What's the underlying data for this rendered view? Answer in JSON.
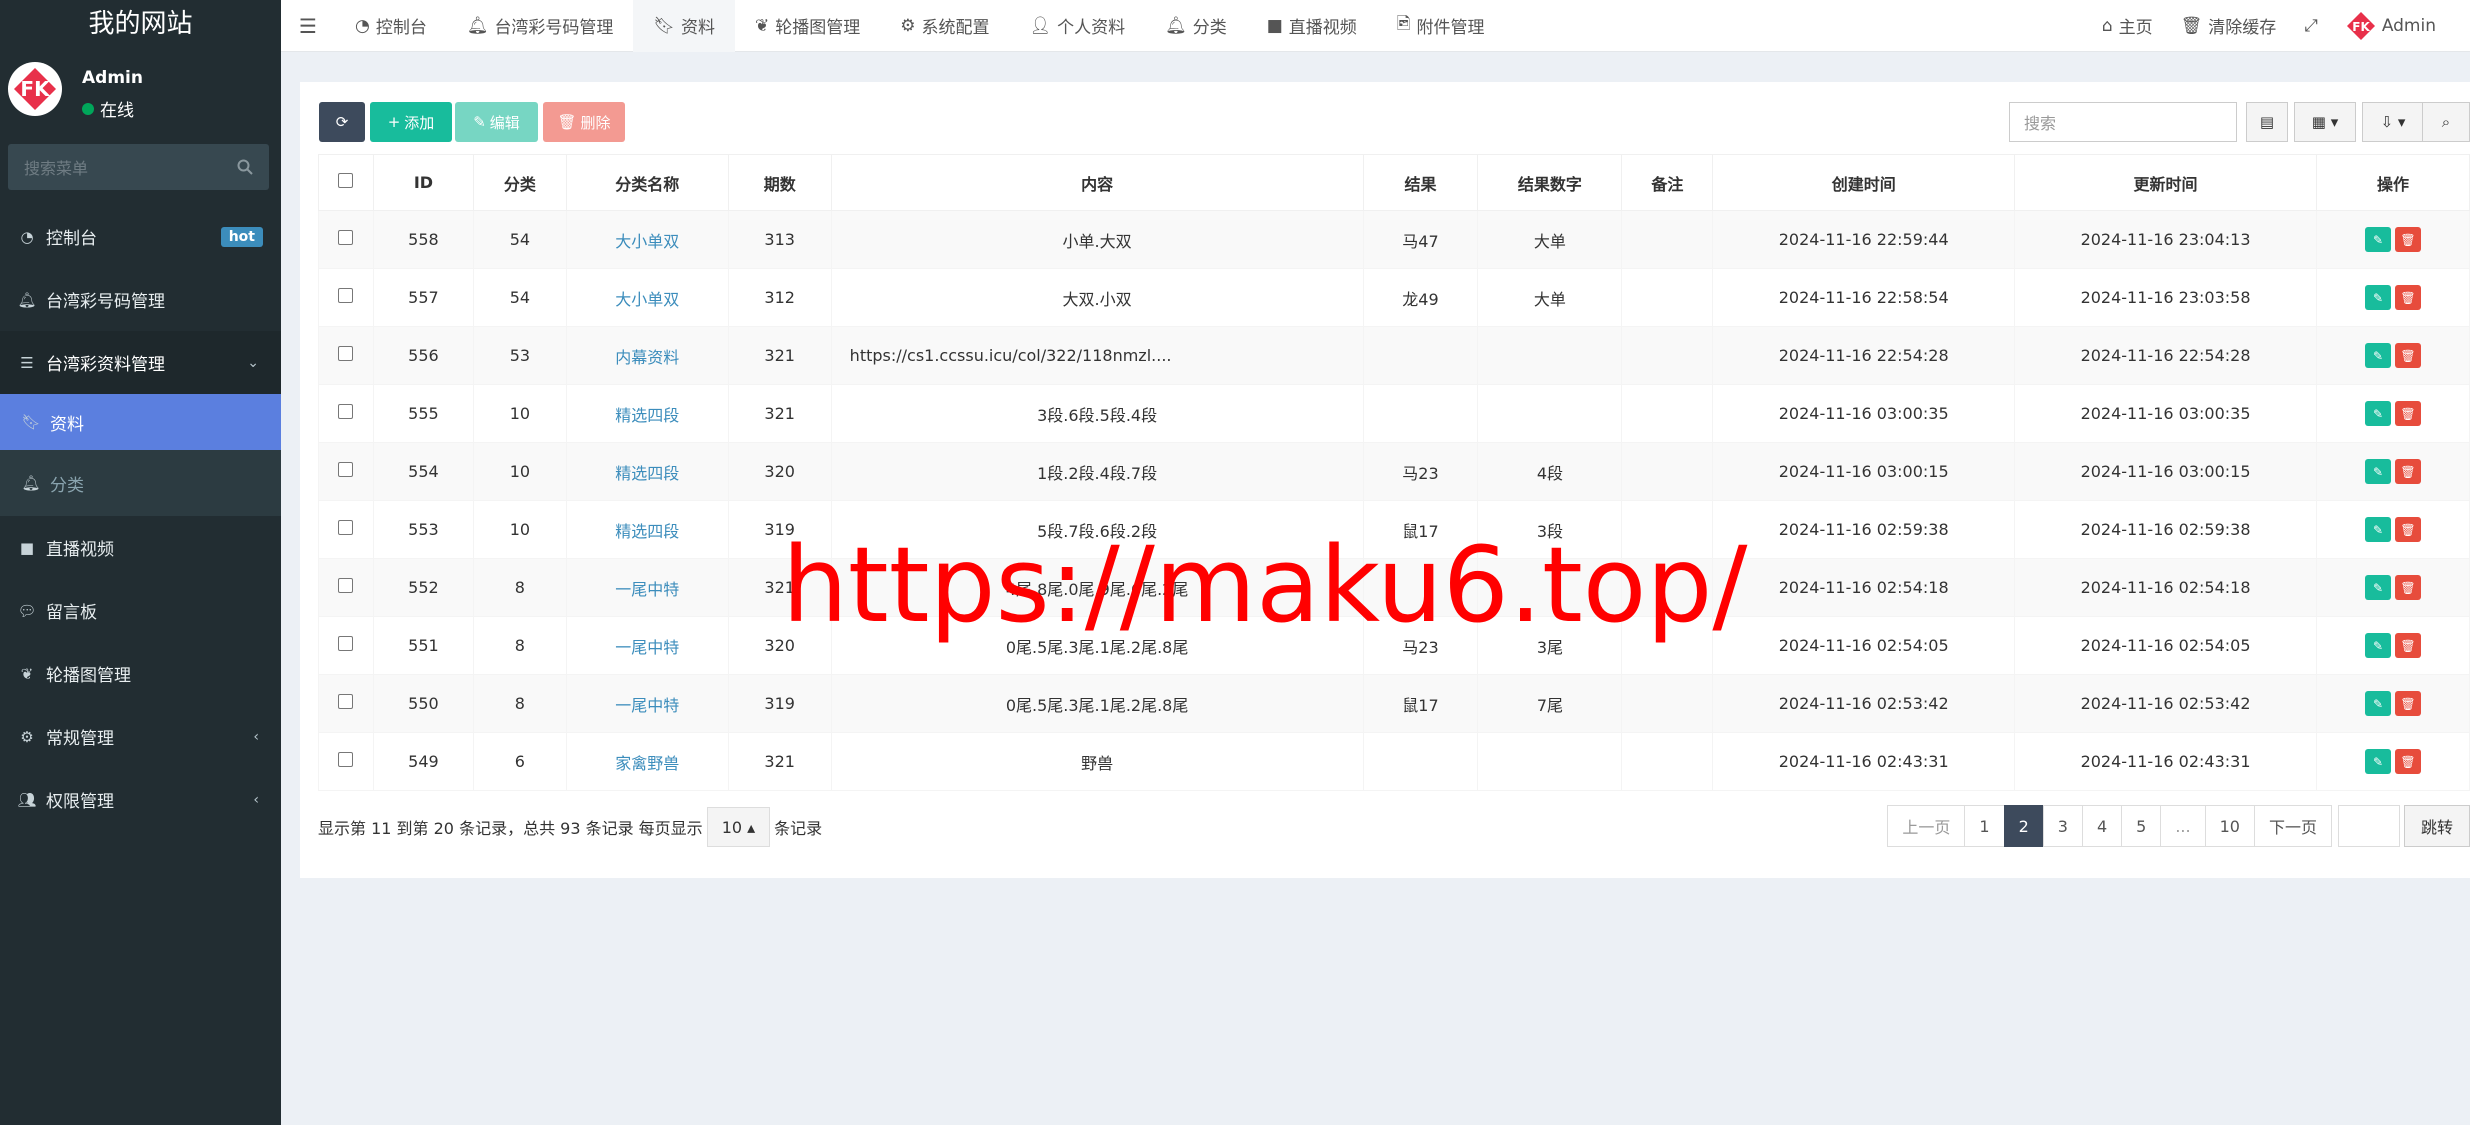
{
  "brand": {
    "title": "我的网站"
  },
  "user": {
    "name": "Admin",
    "status": "在线"
  },
  "side_search": {
    "placeholder": "搜索菜单"
  },
  "menu": [
    {
      "label": "控制台",
      "icon": "dashboard-icon",
      "badge": "hot"
    },
    {
      "label": "台湾彩号码管理",
      "icon": "bell-icon"
    },
    {
      "label": "台湾彩资料管理",
      "icon": "list-icon"
    },
    {
      "label": "资料",
      "icon": "bookmark-icon"
    },
    {
      "label": "分类",
      "icon": "bell-icon"
    },
    {
      "label": "直播视频",
      "icon": "video-icon"
    },
    {
      "label": "留言板",
      "icon": "comment-icon"
    },
    {
      "label": "轮播图管理",
      "icon": "leaf-icon"
    },
    {
      "label": "常规管理",
      "icon": "cogs-icon"
    },
    {
      "label": "权限管理",
      "icon": "users-icon"
    }
  ],
  "tabs": [
    {
      "label": "控制台",
      "icon": "dashboard-icon"
    },
    {
      "label": "台湾彩号码管理",
      "icon": "bell-icon"
    },
    {
      "label": "资料",
      "icon": "bookmark-icon"
    },
    {
      "label": "轮播图管理",
      "icon": "leaf-icon"
    },
    {
      "label": "系统配置",
      "icon": "gear-icon"
    },
    {
      "label": "个人资料",
      "icon": "user-icon"
    },
    {
      "label": "分类",
      "icon": "bell-icon"
    },
    {
      "label": "直播视频",
      "icon": "video-icon"
    },
    {
      "label": "附件管理",
      "icon": "file-image-icon"
    }
  ],
  "topright": {
    "home": "主页",
    "clear_cache": "清除缓存",
    "admin": "Admin"
  },
  "toolbar": {
    "add": "添加",
    "edit": "编辑",
    "delete": "删除",
    "search_placeholder": "搜索"
  },
  "table": {
    "headers": [
      "ID",
      "分类",
      "分类名称",
      "期数",
      "内容",
      "结果",
      "结果数字",
      "备注",
      "创建时间",
      "更新时间",
      "操作"
    ],
    "rows": [
      [
        "558",
        "54",
        "大小单双",
        "313",
        "小单.大双",
        "马47",
        "大单",
        "",
        "2024-11-16 22:59:44",
        "2024-11-16 23:04:13"
      ],
      [
        "557",
        "54",
        "大小单双",
        "312",
        "大双.小双",
        "龙49",
        "大单",
        "",
        "2024-11-16 22:58:54",
        "2024-11-16 23:03:58"
      ],
      [
        "556",
        "53",
        "内幕资料",
        "321",
        "https://cs1.ccssu.icu/col/322/118nmzl....",
        "",
        "",
        "",
        "2024-11-16 22:54:28",
        "2024-11-16 22:54:28"
      ],
      [
        "555",
        "10",
        "精选四段",
        "321",
        "3段.6段.5段.4段",
        "",
        "",
        "",
        "2024-11-16 03:00:35",
        "2024-11-16 03:00:35"
      ],
      [
        "554",
        "10",
        "精选四段",
        "320",
        "1段.2段.4段.7段",
        "马23",
        "4段",
        "",
        "2024-11-16 03:00:15",
        "2024-11-16 03:00:15"
      ],
      [
        "553",
        "10",
        "精选四段",
        "319",
        "5段.7段.6段.2段",
        "鼠17",
        "3段",
        "",
        "2024-11-16 02:59:38",
        "2024-11-16 02:59:38"
      ],
      [
        "552",
        "8",
        "一尾中特",
        "321",
        "4尾.8尾.0尾.9尾.6尾.2尾",
        "",
        "",
        "",
        "2024-11-16 02:54:18",
        "2024-11-16 02:54:18"
      ],
      [
        "551",
        "8",
        "一尾中特",
        "320",
        "0尾.5尾.3尾.1尾.2尾.8尾",
        "马23",
        "3尾",
        "",
        "2024-11-16 02:54:05",
        "2024-11-16 02:54:05"
      ],
      [
        "550",
        "8",
        "一尾中特",
        "319",
        "0尾.5尾.3尾.1尾.2尾.8尾",
        "鼠17",
        "7尾",
        "",
        "2024-11-16 02:53:42",
        "2024-11-16 02:53:42"
      ],
      [
        "549",
        "6",
        "家禽野兽",
        "321",
        "野兽",
        "",
        "",
        "",
        "2024-11-16 02:43:31",
        "2024-11-16 02:43:31"
      ]
    ]
  },
  "footer": {
    "prefix": "显示第 11 到第 20 条记录，总共 93 条记录 每页显示",
    "page_size": "10",
    "suffix": "条记录"
  },
  "pagination": {
    "prev": "上一页",
    "pages": [
      "1",
      "2",
      "3",
      "4",
      "5",
      "...",
      "10"
    ],
    "current": "2",
    "next": "下一页",
    "jump": "跳转"
  },
  "watermark": "https://maku6.top/",
  "colors": {
    "sidebar": "#222d32",
    "active_menu": "#5b7fdf",
    "add": "#18bc9c",
    "edit": "#77d6c3",
    "delete": "#f39a92",
    "refresh": "#3d4a5c",
    "watermark": "#ff0000"
  }
}
